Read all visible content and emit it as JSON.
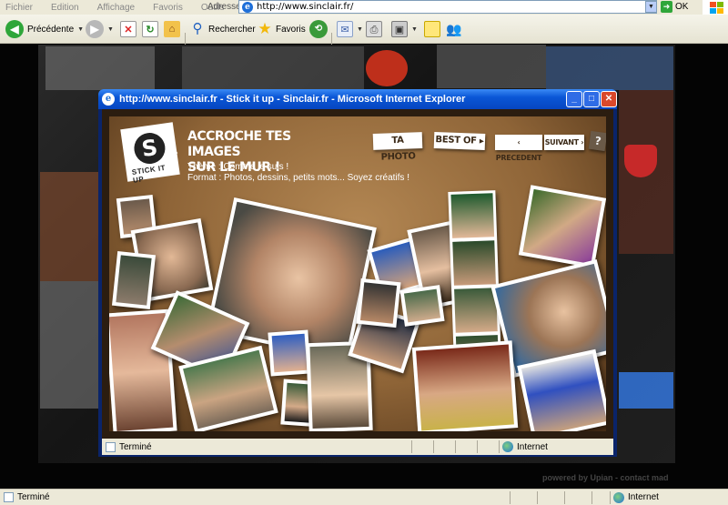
{
  "browser": {
    "menu": [
      "Fichier",
      "Edition",
      "Affichage",
      "Favoris",
      "Outils",
      "?"
    ],
    "address_label": "Adresse",
    "url": "http://www.sinclair.fr/",
    "go_label": "OK",
    "toolbar": {
      "back": "Précédente",
      "search": "Rechercher",
      "favorites": "Favoris"
    },
    "status_text": "Terminé",
    "zone": "Internet"
  },
  "background": {
    "powered_by": "powered by Upian - contact mad"
  },
  "popup": {
    "title": "http://www.sinclair.fr - Stick it up - Sinclair.fr - Microsoft Internet Explorer",
    "status_text": "Terminé",
    "zone": "Internet",
    "flash": {
      "logo_letter": "S",
      "logo_text": "STICK IT UP",
      "headline_1": "ACCROCHE TES IMAGES",
      "headline_2": "SUR LE MUR !",
      "theme": "Thème : Comme je suis !",
      "format": "Format : Photos, dessins, petits mots... Soyez créatifs !",
      "btn_ta_photo": "TA PHOTO",
      "btn_best_of": "BEST OF ▸",
      "btn_precedent": "‹ PRECEDENT",
      "btn_suivant": "SUIVANT ›",
      "btn_help": "?"
    }
  }
}
